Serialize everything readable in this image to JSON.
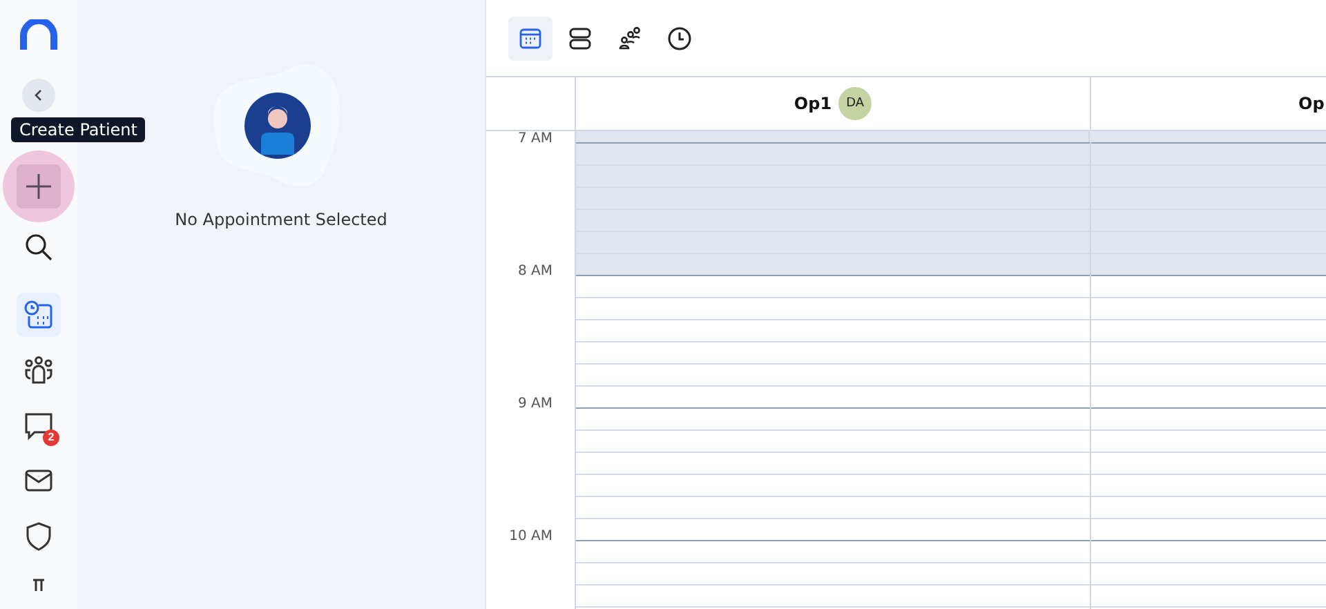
{
  "sidebar": {
    "tooltip": "Create Patient",
    "nav": [
      {
        "kind": "calendar",
        "selected": true
      },
      {
        "kind": "people",
        "selected": false
      },
      {
        "kind": "chat",
        "selected": false,
        "badge": "2"
      },
      {
        "kind": "mail",
        "selected": false
      },
      {
        "kind": "shield",
        "selected": false
      },
      {
        "kind": "flask",
        "selected": false
      }
    ]
  },
  "panel": {
    "message": "No Appointment Selected"
  },
  "toolbar": {
    "views": [
      {
        "kind": "calendar",
        "selected": true
      },
      {
        "kind": "rows",
        "selected": false
      },
      {
        "kind": "people",
        "selected": false
      },
      {
        "kind": "clock",
        "selected": false
      }
    ]
  },
  "schedule": {
    "columns": [
      {
        "label": "Op1",
        "avatar": "DA"
      },
      {
        "label": "Op"
      }
    ],
    "hours": [
      {
        "label": "7 AM",
        "closed": true
      },
      {
        "label": "8 AM",
        "closed": false
      },
      {
        "label": "9 AM",
        "closed": false
      },
      {
        "label": "10 AM",
        "closed": false
      }
    ]
  }
}
